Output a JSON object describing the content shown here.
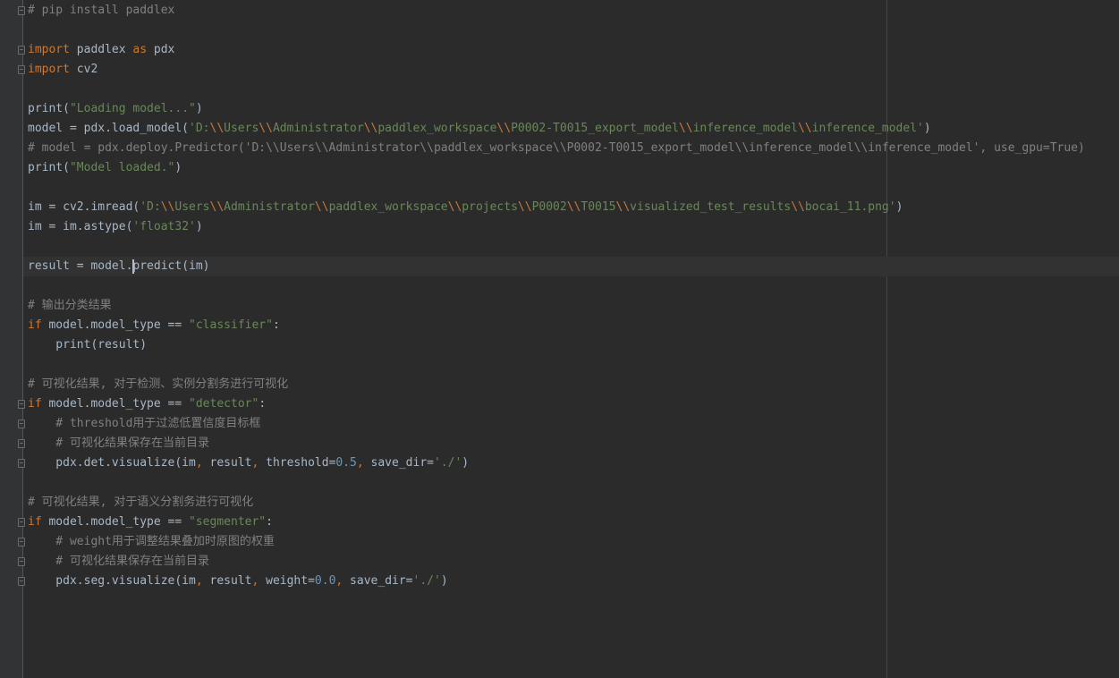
{
  "editor": {
    "lines": [
      [
        {
          "t": "# pip install paddlex",
          "c": "com"
        }
      ],
      [],
      [
        {
          "t": "import",
          "c": "kw"
        },
        {
          "t": " paddlex ",
          "c": "tx"
        },
        {
          "t": "as",
          "c": "kw"
        },
        {
          "t": " pdx",
          "c": "tx"
        }
      ],
      [
        {
          "t": "import",
          "c": "kw"
        },
        {
          "t": " cv2",
          "c": "tx"
        }
      ],
      [],
      [
        {
          "t": "print(",
          "c": "tx"
        },
        {
          "t": "\"Loading model...\"",
          "c": "str"
        },
        {
          "t": ")",
          "c": "tx"
        }
      ],
      [
        {
          "t": "model = pdx.load_model(",
          "c": "tx"
        },
        {
          "t": "'D:",
          "c": "str"
        },
        {
          "t": "\\\\",
          "c": "esc"
        },
        {
          "t": "Users",
          "c": "str"
        },
        {
          "t": "\\\\",
          "c": "esc"
        },
        {
          "t": "Administrator",
          "c": "str"
        },
        {
          "t": "\\\\",
          "c": "esc"
        },
        {
          "t": "paddlex_workspace",
          "c": "str"
        },
        {
          "t": "\\\\",
          "c": "esc"
        },
        {
          "t": "P0002-T0015_export_model",
          "c": "str"
        },
        {
          "t": "\\\\",
          "c": "esc"
        },
        {
          "t": "inference_model",
          "c": "str"
        },
        {
          "t": "\\\\",
          "c": "esc"
        },
        {
          "t": "inference_model'",
          "c": "str"
        },
        {
          "t": ")",
          "c": "tx"
        }
      ],
      [
        {
          "t": "# model = pdx.deploy.Predictor('D:\\\\Users\\\\Administrator\\\\paddlex_workspace\\\\P0002-T0015_export_model\\\\inference_model\\\\inference_model', use_gpu=True)",
          "c": "com"
        }
      ],
      [
        {
          "t": "print(",
          "c": "tx"
        },
        {
          "t": "\"Model loaded.\"",
          "c": "str"
        },
        {
          "t": ")",
          "c": "tx"
        }
      ],
      [],
      [
        {
          "t": "im = cv2.imread(",
          "c": "tx"
        },
        {
          "t": "'D:",
          "c": "str"
        },
        {
          "t": "\\\\",
          "c": "esc"
        },
        {
          "t": "Users",
          "c": "str"
        },
        {
          "t": "\\\\",
          "c": "esc"
        },
        {
          "t": "Administrator",
          "c": "str"
        },
        {
          "t": "\\\\",
          "c": "esc"
        },
        {
          "t": "paddlex_workspace",
          "c": "str"
        },
        {
          "t": "\\\\",
          "c": "esc"
        },
        {
          "t": "projects",
          "c": "str"
        },
        {
          "t": "\\\\",
          "c": "esc"
        },
        {
          "t": "P0002",
          "c": "str"
        },
        {
          "t": "\\\\",
          "c": "esc"
        },
        {
          "t": "T0015",
          "c": "str"
        },
        {
          "t": "\\\\",
          "c": "esc"
        },
        {
          "t": "visualized_test_results",
          "c": "str"
        },
        {
          "t": "\\\\",
          "c": "esc"
        },
        {
          "t": "bocai_11.png'",
          "c": "str"
        },
        {
          "t": ")",
          "c": "tx"
        }
      ],
      [
        {
          "t": "im = im.astype(",
          "c": "tx"
        },
        {
          "t": "'float32'",
          "c": "str"
        },
        {
          "t": ")",
          "c": "tx"
        }
      ],
      [],
      [
        {
          "t": "result = model.",
          "c": "tx"
        },
        {
          "t": "|",
          "c": "caret"
        },
        {
          "t": "predict(im)",
          "c": "tx"
        }
      ],
      [],
      [
        {
          "t": "# 输出分类结果",
          "c": "com"
        }
      ],
      [
        {
          "t": "if",
          "c": "kw"
        },
        {
          "t": " model.model_type == ",
          "c": "tx"
        },
        {
          "t": "\"classifier\"",
          "c": "str"
        },
        {
          "t": ":",
          "c": "tx"
        }
      ],
      [
        {
          "t": "    print(result)",
          "c": "tx"
        }
      ],
      [],
      [
        {
          "t": "# 可视化结果, 对于检测、实例分割务进行可视化",
          "c": "com"
        }
      ],
      [
        {
          "t": "if",
          "c": "kw"
        },
        {
          "t": " model.model_type == ",
          "c": "tx"
        },
        {
          "t": "\"detector\"",
          "c": "str"
        },
        {
          "t": ":",
          "c": "tx"
        }
      ],
      [
        {
          "t": "    # threshold用于过滤低置信度目标框",
          "c": "com"
        }
      ],
      [
        {
          "t": "    # 可视化结果保存在当前目录",
          "c": "com"
        }
      ],
      [
        {
          "t": "    pdx.det.visualize(im",
          "c": "tx"
        },
        {
          "t": ",",
          "c": "kw"
        },
        {
          "t": " result",
          "c": "tx"
        },
        {
          "t": ",",
          "c": "kw"
        },
        {
          "t": " threshold=",
          "c": "tx"
        },
        {
          "t": "0.5",
          "c": "num"
        },
        {
          "t": ",",
          "c": "kw"
        },
        {
          "t": " save_dir=",
          "c": "tx"
        },
        {
          "t": "'./'",
          "c": "str"
        },
        {
          "t": ")",
          "c": "tx"
        }
      ],
      [],
      [
        {
          "t": "# 可视化结果, 对于语义分割务进行可视化",
          "c": "com"
        }
      ],
      [
        {
          "t": "if",
          "c": "kw"
        },
        {
          "t": " model.model_type == ",
          "c": "tx"
        },
        {
          "t": "\"segmenter\"",
          "c": "str"
        },
        {
          "t": ":",
          "c": "tx"
        }
      ],
      [
        {
          "t": "    # weight用于调整结果叠加时原图的权重",
          "c": "com"
        }
      ],
      [
        {
          "t": "    # 可视化结果保存在当前目录",
          "c": "com"
        }
      ],
      [
        {
          "t": "    pdx.seg.visualize(im",
          "c": "tx"
        },
        {
          "t": ",",
          "c": "kw"
        },
        {
          "t": " result",
          "c": "tx"
        },
        {
          "t": ",",
          "c": "kw"
        },
        {
          "t": " weight=",
          "c": "tx"
        },
        {
          "t": "0.0",
          "c": "num"
        },
        {
          "t": ",",
          "c": "kw"
        },
        {
          "t": " save_dir=",
          "c": "tx"
        },
        {
          "t": "'./'",
          "c": "str"
        },
        {
          "t": ")",
          "c": "tx"
        }
      ]
    ],
    "fold_marker_lines": [
      0,
      2,
      3,
      20,
      21,
      22,
      23,
      26,
      27,
      28,
      29
    ],
    "colors": {
      "background": "#2b2b2b",
      "gutter": "#313335",
      "keyword": "#cc7832",
      "string": "#6a8759",
      "number": "#6897bb",
      "comment": "#808080",
      "text": "#a9b7c6"
    }
  }
}
